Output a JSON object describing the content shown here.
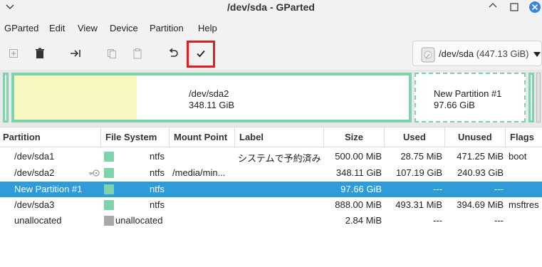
{
  "window": {
    "title": "/dev/sda - GParted"
  },
  "menu": [
    "GParted",
    "Edit",
    "View",
    "Device",
    "Partition",
    "Help"
  ],
  "toolbar": {
    "device_path": "/dev/sda",
    "device_size": "(447.13 GiB)"
  },
  "disk_map": {
    "sda2": {
      "name": "/dev/sda2",
      "size": "348.11 GiB"
    },
    "new": {
      "name": "New Partition #1",
      "size": "97.66 GiB"
    }
  },
  "table": {
    "headers": [
      "Partition",
      "File System",
      "Mount Point",
      "Label",
      "Size",
      "Used",
      "Unused",
      "Flags"
    ],
    "rows": [
      {
        "partition": "/dev/sda1",
        "fs": "ntfs",
        "mount": "",
        "label": "システムで予約済み",
        "size": "500.00 MiB",
        "used": "28.75 MiB",
        "unused": "471.25 MiB",
        "flags": "boot",
        "color": "#7ed3ad",
        "selected": false
      },
      {
        "partition": "/dev/sda2",
        "fs": "ntfs",
        "mount": "/media/min...",
        "label": "",
        "size": "348.11 GiB",
        "used": "107.19 GiB",
        "unused": "240.93 GiB",
        "flags": "",
        "color": "#7ed3ad",
        "selected": false
      },
      {
        "partition": "New Partition #1",
        "fs": "ntfs",
        "mount": "",
        "label": "",
        "size": "97.66 GiB",
        "used": "---",
        "unused": "---",
        "flags": "",
        "color": "#7ed3ad",
        "selected": true
      },
      {
        "partition": "/dev/sda3",
        "fs": "ntfs",
        "mount": "",
        "label": "",
        "size": "888.00 MiB",
        "used": "493.31 MiB",
        "unused": "394.69 MiB",
        "flags": "msftres",
        "color": "#7ed3ad",
        "selected": false
      },
      {
        "partition": "unallocated",
        "fs": "unallocated",
        "mount": "",
        "label": "",
        "size": "2.84 MiB",
        "used": "---",
        "unused": "---",
        "flags": "",
        "color": "#a8a8a8",
        "selected": false
      }
    ]
  }
}
